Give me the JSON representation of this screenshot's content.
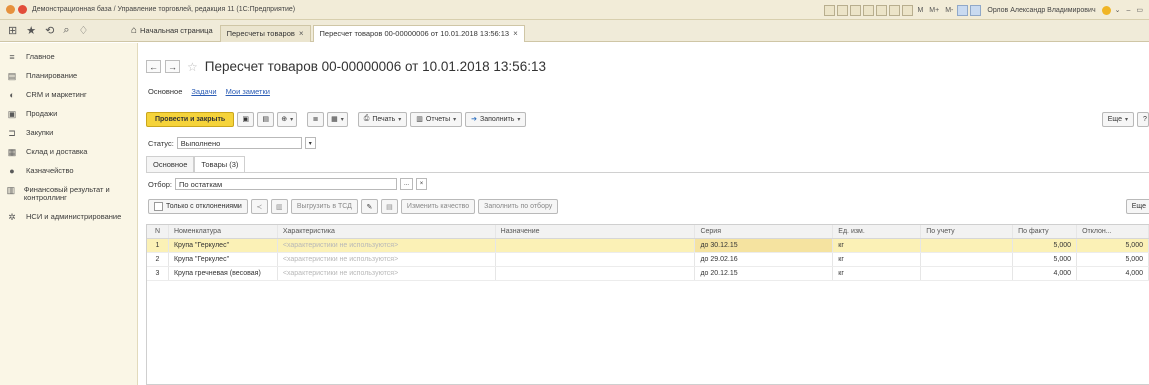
{
  "window": {
    "title": "Демонстрационная база / Управление торговлей, редакция 11 (1С:Предприятие)",
    "user": "Орлов Александр Владимирович",
    "toolbar_texts": [
      "M",
      "M+",
      "M-"
    ]
  },
  "tabs": {
    "home": "Начальная страница",
    "items": [
      {
        "label": "Пересчеты товаров"
      },
      {
        "label": "Пересчет товаров 00-00000006 от 10.01.2018 13:56:13"
      }
    ]
  },
  "sidebar": {
    "items": [
      {
        "label": "Главное",
        "icon": "menu-icon"
      },
      {
        "label": "Планирование",
        "icon": "planning-icon"
      },
      {
        "label": "CRM и маркетинг",
        "icon": "crm-icon"
      },
      {
        "label": "Продажи",
        "icon": "sales-icon"
      },
      {
        "label": "Закупки",
        "icon": "cart-icon"
      },
      {
        "label": "Склад и доставка",
        "icon": "warehouse-icon"
      },
      {
        "label": "Казначейство",
        "icon": "treasury-icon"
      },
      {
        "label": "Финансовый результат и контроллинг",
        "icon": "chart-icon"
      },
      {
        "label": "НСИ и администрирование",
        "icon": "gear-icon"
      }
    ]
  },
  "document": {
    "title": "Пересчет товаров 00-00000006 от 10.01.2018 13:56:13",
    "subtabs": [
      "Основное",
      "Задачи",
      "Мои заметки"
    ]
  },
  "toolbar": {
    "post_close": "Провести и закрыть",
    "print": "Печать",
    "reports": "Отчеты",
    "fill": "Заполнить",
    "more": "Еще",
    "help": "?"
  },
  "status": {
    "label": "Статус:",
    "value": "Выполнено"
  },
  "inner_tabs": [
    "Основное",
    "Товары (3)"
  ],
  "filter": {
    "label": "Отбор:",
    "value": "По остаткам"
  },
  "table_tools": {
    "only_deviations": "Только с отклонениями",
    "unload": "Выгрузить в ТСД",
    "change_quality": "Изменить качество",
    "fill_by_filter": "Заполнить по отбору",
    "more": "Еще"
  },
  "table": {
    "columns": [
      "N",
      "Номенклатура",
      "Характеристика",
      "Назначение",
      "Серия",
      "Ед. изм.",
      "По учету",
      "По факту",
      "Отклон..."
    ],
    "rows": [
      {
        "n": "1",
        "name": "Крупа \"Геркулес\"",
        "char": "<характеристики не используются>",
        "purpose": "",
        "series": "до 30.12.15",
        "unit": "кг",
        "by_account": "",
        "by_fact": "5,000",
        "dev": "5,000"
      },
      {
        "n": "2",
        "name": "Крупа \"Геркулес\"",
        "char": "<характеристики не используются>",
        "purpose": "",
        "series": "до 29.02.16",
        "unit": "кг",
        "by_account": "",
        "by_fact": "5,000",
        "dev": "5,000"
      },
      {
        "n": "3",
        "name": "Крупа гречневая (весовая)",
        "char": "<характеристики не используются>",
        "purpose": "",
        "series": "до 20.12.15",
        "unit": "кг",
        "by_account": "",
        "by_fact": "4,000",
        "dev": "4,000"
      }
    ]
  },
  "colors": {
    "accent": "#f5d33a",
    "selected_row": "#fbf1b6",
    "link": "#2c5db5"
  }
}
